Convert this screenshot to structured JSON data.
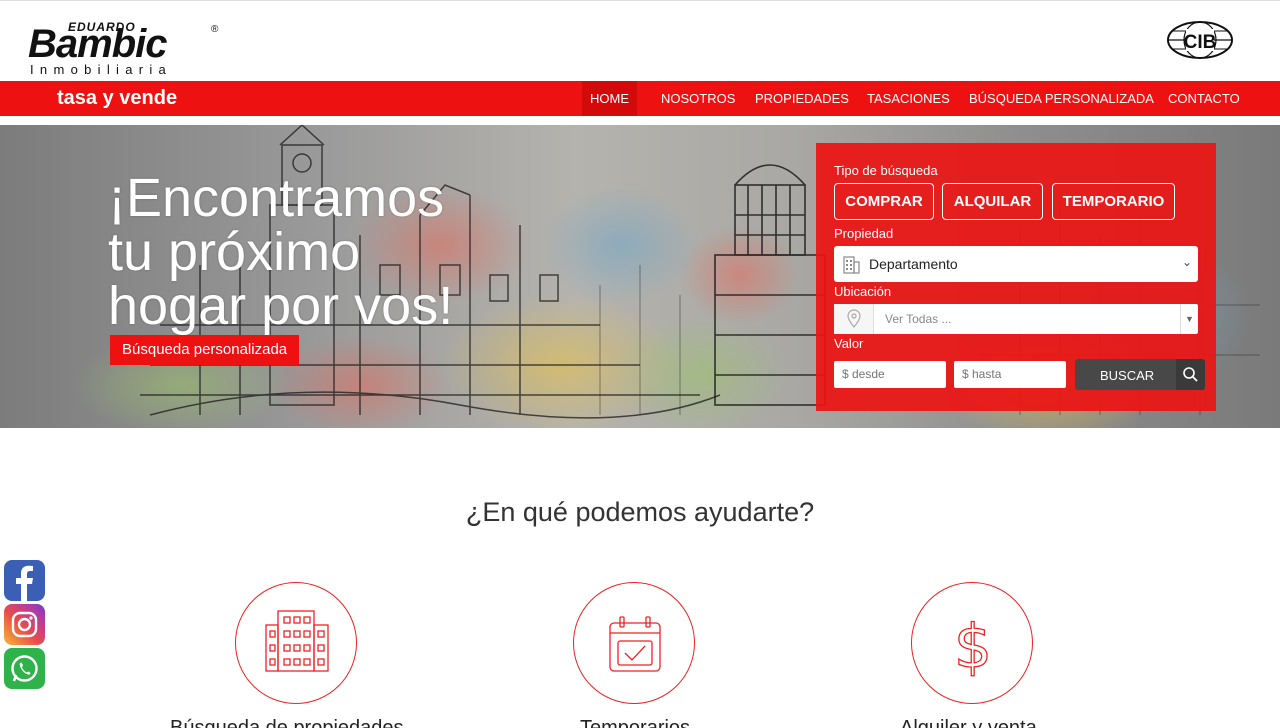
{
  "brand": {
    "top": "EDUARDO",
    "name": "Bambic",
    "reg": "®",
    "sub": "Inmobiliaria",
    "cib_logo": "CIB"
  },
  "navbar": {
    "tagline": "tasa y vende",
    "items": [
      "HOME",
      "NOSOTROS",
      "PROPIEDADES",
      "TASACIONES",
      "BÚSQUEDA PERSONALIZADA",
      "CONTACTO"
    ],
    "active": "HOME",
    "color": "#ee1111"
  },
  "hero": {
    "line1": "¡Encontramos",
    "line2": "tu próximo",
    "line3": "hogar por vos!",
    "button": "Búsqueda personalizada"
  },
  "search": {
    "tipo_label": "Tipo de búsqueda",
    "types": [
      "COMPRAR",
      "ALQUILAR",
      "TEMPORARIO"
    ],
    "propiedad_label": "Propiedad",
    "propiedad_value": "Departamento",
    "ubicacion_label": "Ubicación",
    "ubicacion_placeholder": "Ver Todas ...",
    "valor_label": "Valor",
    "desde_placeholder": "$ desde",
    "hasta_placeholder": "$ hasta",
    "buscar": "BUSCAR"
  },
  "help": {
    "title": "¿En qué podemos ayudarte?",
    "items": [
      {
        "icon": "building-icon",
        "label": "Búsqueda de propiedades"
      },
      {
        "icon": "calendar-icon",
        "label": "Temporarios"
      },
      {
        "icon": "dollar-icon",
        "label": "Alquiler y venta"
      }
    ]
  },
  "social": [
    "facebook-icon",
    "instagram-icon",
    "whatsapp-icon"
  ]
}
